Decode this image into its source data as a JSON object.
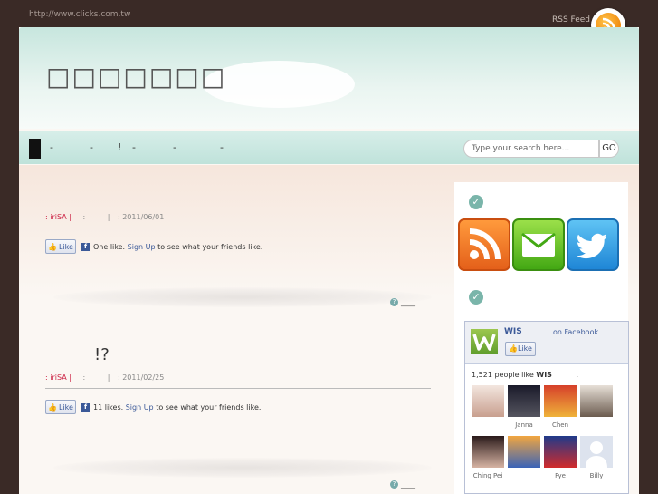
{
  "topbar": {
    "url": "http://www.clicks.com.tw",
    "rss_label": "RSS Feed"
  },
  "site": {
    "title": "□□□□□□□"
  },
  "nav": {
    "items": [
      "-",
      "-",
      "!",
      "-",
      "-",
      "-"
    ]
  },
  "search": {
    "placeholder": "Type your search here...",
    "button": "GO"
  },
  "posts": [
    {
      "title": "",
      "author": ": iriSA |",
      "sep1": ":",
      "sep2": "|",
      "date": ": 2011/06/01",
      "like_label": "Like",
      "like_text": "One like.",
      "signup": "Sign Up",
      "rest": "to see what your friends like.",
      "more": "____"
    },
    {
      "title": "!?",
      "author": ": iriSA |",
      "sep1": ":",
      "sep2": "|",
      "date": ": 2011/02/25",
      "like_label": "Like",
      "like_text": "11 likes.",
      "signup": "Sign Up",
      "rest": "to see what your friends like.",
      "more": "____"
    }
  ],
  "sidebar": {
    "icons": [
      "rss-icon",
      "mail-icon",
      "twitter-bird-icon"
    ],
    "fb": {
      "name": "WIS",
      "on": "on Facebook",
      "like": "Like",
      "count_text": "1,521 people like",
      "count_name": "WIS",
      "count_end": ".",
      "fans": [
        "",
        "Janna",
        "Chen",
        "",
        "Ching Pei",
        "",
        "Fye",
        "Billy"
      ]
    }
  },
  "colors": {
    "accent": "#7ab5aa",
    "fb_blue": "#3b5998",
    "author": "#cc2244"
  }
}
